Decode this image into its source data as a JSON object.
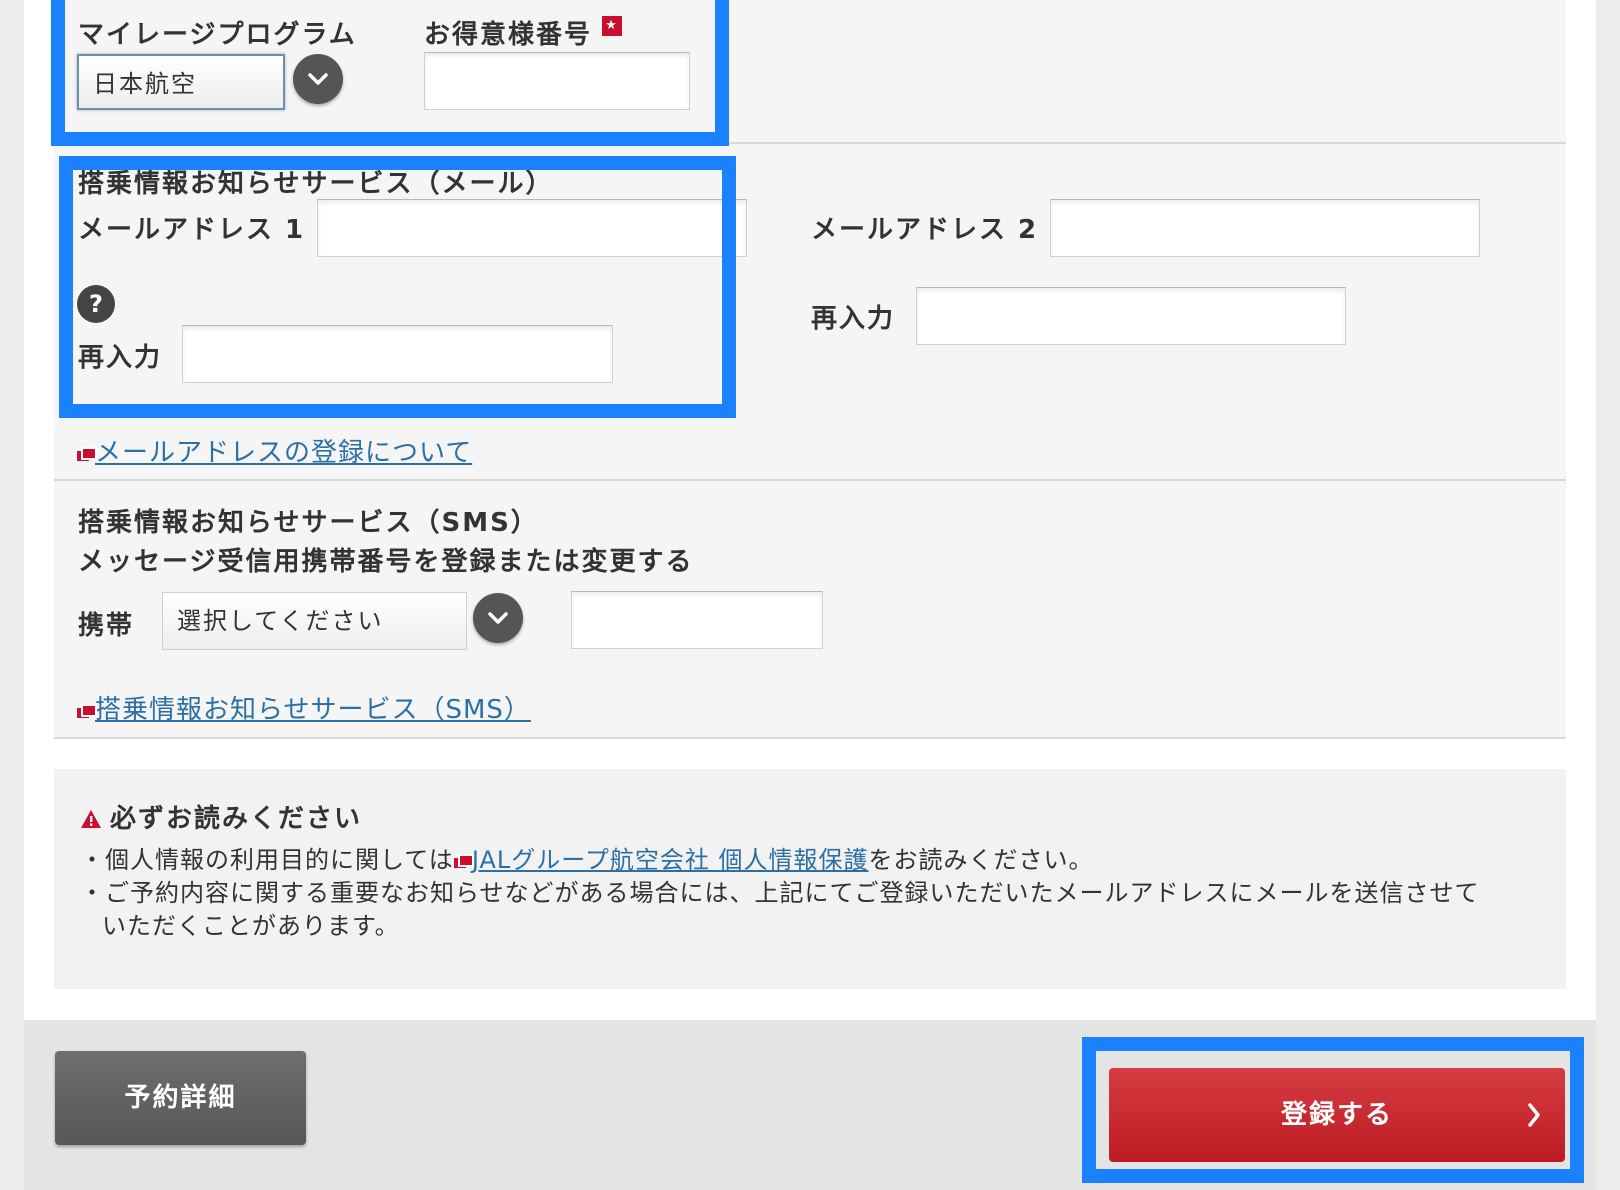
{
  "mileage": {
    "program_label": "マイレージプログラム",
    "program_value": "日本航空",
    "member_label": "お得意様番号",
    "required_mark": "★",
    "member_value": ""
  },
  "email_service": {
    "title": "搭乗情報お知らせサービス（メール）",
    "email1_label": "メールアドレス 1",
    "email1_value": "",
    "help_icon": "?",
    "reenter1_label": "再入力",
    "reenter1_value": "",
    "email2_label": "メールアドレス 2",
    "email2_value": "",
    "reenter2_label": "再入力",
    "reenter2_value": "",
    "link_text": "メールアドレスの登録について"
  },
  "sms_service": {
    "title": "搭乗情報お知らせサービス（SMS）",
    "subtitle": "メッセージ受信用携帯番号を登録または変更する",
    "mobile_label": "携帯",
    "mobile_select": "選択してください",
    "mobile_number": "",
    "link_text": "搭乗情報お知らせサービス（SMS）"
  },
  "notice": {
    "title": "必ずお読みください",
    "line1_prefix": "・個人情報の利用目的に関しては",
    "line1_link": "JALグループ航空会社 個人情報保護",
    "line1_suffix": "をお読みください。",
    "line2": "・ご予約内容に関する重要なお知らせなどがある場合には、上記にてご登録いただいたメールアドレスにメールを送信させて",
    "line3": "いただくことがあります。"
  },
  "buttons": {
    "details": "予約詳細",
    "register": "登録する"
  },
  "colors": {
    "highlight": "#1a82ff",
    "primary_button": "#c8242b",
    "link": "#2c6fa5",
    "accent_red": "#c8102e"
  },
  "icons": [
    "chevron-down-icon",
    "help-icon",
    "pdf-icon",
    "warning-icon",
    "chevron-right-icon"
  ]
}
